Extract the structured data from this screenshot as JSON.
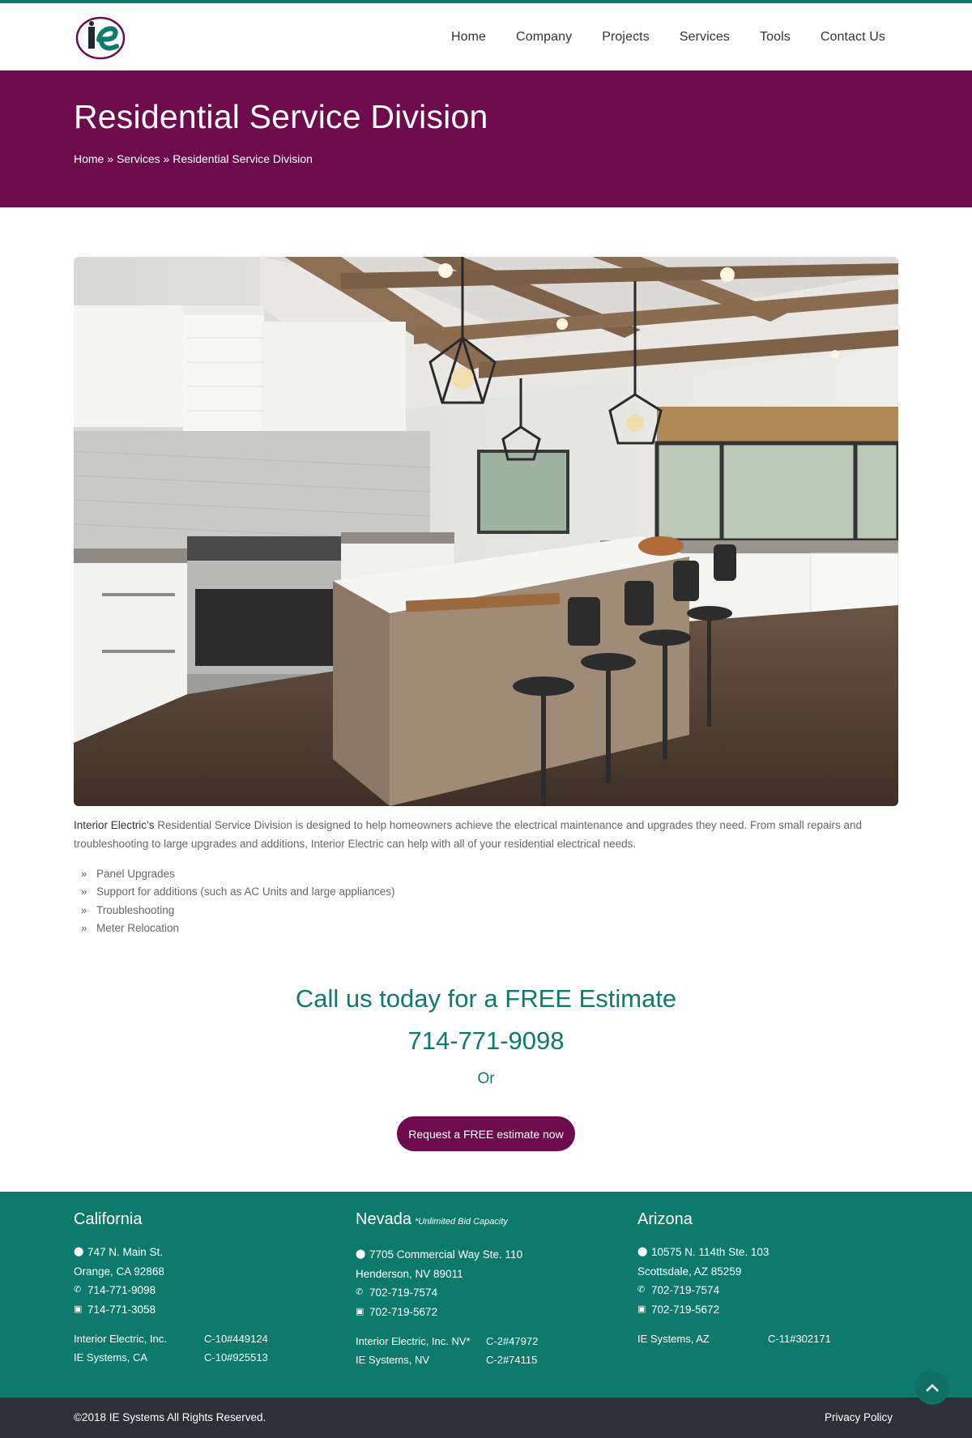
{
  "brand": {
    "logo_text": "ie",
    "teal": "#0e7a6c",
    "plum": "#6d0b4d",
    "dark": "#2e3037"
  },
  "nav": {
    "items": [
      "Home",
      "Company",
      "Projects",
      "Services",
      "Tools",
      "Contact Us"
    ]
  },
  "hero": {
    "title": "Residential Service Division",
    "breadcrumb": {
      "home": "Home",
      "sep1": "»",
      "services": "Services",
      "sep2": "»",
      "current": "Residential Service Division"
    }
  },
  "content": {
    "intro_bold": "Interior Electric’s",
    "intro_text": " Residential Service Division is designed to help homeowners achieve the electrical maintenance and upgrades they need. From small repairs and troubleshooting to large upgrades and additions, Interior Electric can help with all of your residential electrical needs.",
    "features": [
      "Panel Upgrades",
      "Support for additions (such as AC Units and large appliances)",
      "Troubleshooting",
      "Meter Relocation"
    ]
  },
  "cta": {
    "title": "Call us today for a FREE Estimate",
    "phone": "714-771-9098",
    "or": "Or",
    "button": "Request a FREE estimate now"
  },
  "footer": {
    "california": {
      "title": "California",
      "address1": "747 N. Main St.",
      "address2": "Orange, CA 92868",
      "phone": "714-771-9098",
      "fax": "714-771-3058",
      "licenses": [
        {
          "name": "Interior Electric, Inc.",
          "number": "C-10#449124"
        },
        {
          "name": "IE Systems, CA",
          "number": "C-10#925513"
        }
      ]
    },
    "nevada": {
      "title": "Nevada",
      "note": "*Unlimited Bid Capacity",
      "address1": "7705 Commercial Way Ste. 110",
      "address2": "Henderson, NV 89011",
      "phone": "702-719-7574",
      "fax": "702-719-5672",
      "licenses": [
        {
          "name": "Interior Electric, Inc. NV*",
          "number": "C-2#47972"
        },
        {
          "name": "IE Systems, NV",
          "number": "C-2#74115"
        }
      ]
    },
    "arizona": {
      "title": "Arizona",
      "address1": "10575 N. 114th Ste. 103",
      "address2": "Scottsdale, AZ 85259",
      "phone": "702-719-7574",
      "fax": "702-719-5672",
      "licenses": [
        {
          "name": "IE Systems, AZ",
          "number": "C-11#302171"
        }
      ]
    }
  },
  "bottom": {
    "copyright": "©2018 IE Systems All Rights Reserved.",
    "privacy": "Privacy Policy"
  },
  "icons": {
    "map": "map-marker-icon",
    "phone": "phone-icon",
    "fax": "fax-icon",
    "chevron": "double-chevron-right-icon",
    "top": "chevron-up-icon"
  }
}
